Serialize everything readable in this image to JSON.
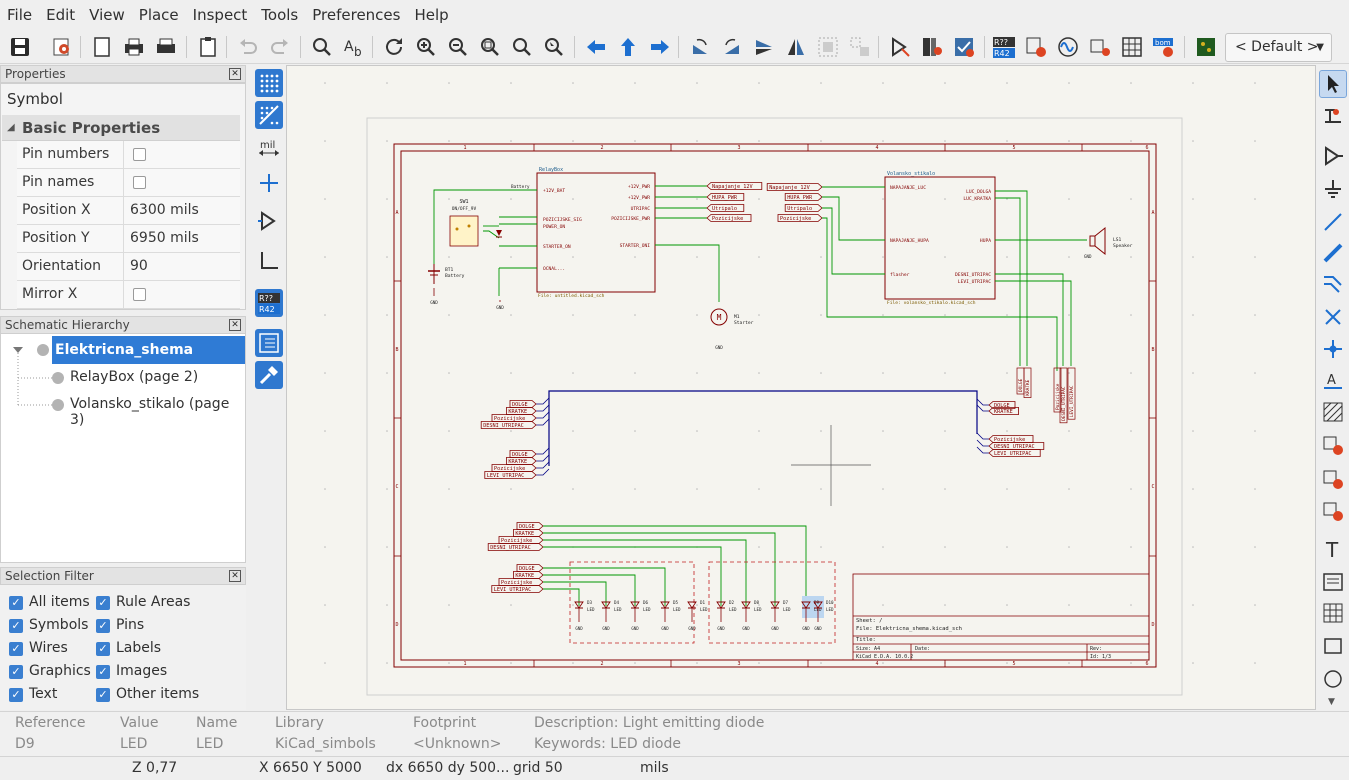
{
  "menu": [
    "File",
    "Edit",
    "View",
    "Place",
    "Inspect",
    "Tools",
    "Preferences",
    "Help"
  ],
  "toolbar": {
    "view_preset": "< Default >"
  },
  "properties": {
    "title": "Properties",
    "selected_type": "Symbol",
    "group": "Basic Properties",
    "rows": [
      {
        "name": "Pin numbers",
        "value": "",
        "checkbox": true
      },
      {
        "name": "Pin names",
        "value": "",
        "checkbox": true
      },
      {
        "name": "Position X",
        "value": "6300 mils",
        "checkbox": false
      },
      {
        "name": "Position Y",
        "value": "6950 mils",
        "checkbox": false
      },
      {
        "name": "Orientation",
        "value": "90",
        "checkbox": false
      },
      {
        "name": "Mirror X",
        "value": "",
        "checkbox": true
      }
    ]
  },
  "hierarchy": {
    "title": "Schematic Hierarchy",
    "root": "Elektricna_shema (page 1)",
    "children": [
      "RelayBox (page 2)",
      "Volansko_stikalo (page 3)"
    ]
  },
  "selection_filter": {
    "title": "Selection Filter",
    "items": [
      "All items",
      "Rule Areas",
      "Symbols",
      "Pins",
      "Wires",
      "Labels",
      "Graphics",
      "Images",
      "Text",
      "Other items"
    ]
  },
  "info": {
    "headers": {
      "reference": "Reference",
      "value": "Value",
      "name": "Name",
      "library": "Library",
      "footprint": "Footprint",
      "description": "Description:",
      "keywords": "Keywords:"
    },
    "values": {
      "reference": "D9",
      "value": "LED",
      "name": "LED",
      "library": "KiCad_simbols",
      "footprint": "<Unknown>",
      "description": "Light emitting diode",
      "keywords": "LED diode"
    }
  },
  "status": {
    "zoom": "Z 0,77",
    "xy": "X 6650  Y 5000",
    "dxdy": "dx 6650  dy 500...",
    "grid": "grid 50",
    "units": "mils"
  },
  "schematic": {
    "relaybox": {
      "title": "RelayBox",
      "file": "File: untitled.kicad_sch",
      "pins_left": [
        "+12V_BAT",
        "POZICIJSKE_SIG",
        "POWER_ON",
        "STARTER_ON",
        "OCNAL..."
      ],
      "pins_right": [
        "+12V_PWR",
        "+12V_PWR",
        "UTRIPAC",
        "POZICIJSKE_PWR",
        "STARTER_ONI"
      ],
      "nets_right": [
        "Napajanje_12V",
        "HUPA_PWR",
        "Utripalo",
        "Pozicijske"
      ]
    },
    "volansko": {
      "title": "Volansko_stikalo",
      "file": "File: volansko_stikalo.kicad_sch",
      "pins_left": [
        "NAPAJANJE_LUC",
        "NAPAJANJE_HUPA",
        "flasher"
      ],
      "pins_right": [
        "LUC_DOLGA",
        "LUC_KRATKA",
        "HUPA",
        "DESNI_UTRIPAC",
        "LEVI_UTRIPAC"
      ],
      "nets_left": [
        "Napajanje_12V",
        "HUPA_PWR",
        "Utripalo",
        "Pozicijske"
      ]
    },
    "switch": {
      "ref": "SW1",
      "value": "ON/OFF_9V"
    },
    "battery": {
      "ref": "BT1",
      "value": "Battery"
    },
    "motor": {
      "ref": "M1",
      "value": "Starter"
    },
    "speaker": {
      "ref": "LS1",
      "value": "Speaker"
    },
    "gnd": "GND",
    "bus_labels_left_a": [
      "DOLGE",
      "KRATKE",
      "Pozicijske",
      "DESNI_UTRIPAC"
    ],
    "bus_labels_left_b": [
      "DOLGE",
      "KRATKE",
      "Pozicijske",
      "LEVI_UTRIPAC"
    ],
    "bus_labels_right_a": [
      "DOLGE",
      "KRATKE"
    ],
    "bus_labels_right_b": [
      "Pozicijske",
      "DESNI_UTRIPAC",
      "LEVI_UTRIPAC"
    ],
    "vertical_labels": [
      "DOLGE",
      "KRATKE",
      "Pozicijske",
      "DESNI_UTRIPAC",
      "LEVI_UTRIPAC"
    ],
    "led_group_labels_a": [
      "DOLGE",
      "KRATKE",
      "Pozicijske",
      "DESNI_UTRIPAC"
    ],
    "led_group_labels_b": [
      "DOLGE",
      "KRATKE",
      "Pozicijske",
      "LEVI_UTRIPAC"
    ],
    "leds_left": [
      "D3",
      "D4",
      "D6",
      "D5",
      "D1"
    ],
    "leds_right": [
      "D2",
      "D8",
      "D7",
      "D9",
      "D10"
    ],
    "led_value": "LED",
    "titleblock": {
      "sheet": "Sheet: /",
      "file": "File: Elektricna_shema.kicad_sch",
      "title": "Title:",
      "size": "Size: A4",
      "date": "Date:",
      "rev": "Rev:",
      "tool": "KiCad E.D.A. 10.0.2",
      "id": "Id: 1/3"
    },
    "border_cols": [
      "1",
      "2",
      "3",
      "4",
      "5",
      "6"
    ],
    "border_rows": [
      "A",
      "B",
      "C",
      "D"
    ]
  },
  "colors": {
    "sheet_border": "#840000",
    "wire": "#009600",
    "bus": "#000084",
    "label": "#840000",
    "selection": "#2f7bd5"
  }
}
